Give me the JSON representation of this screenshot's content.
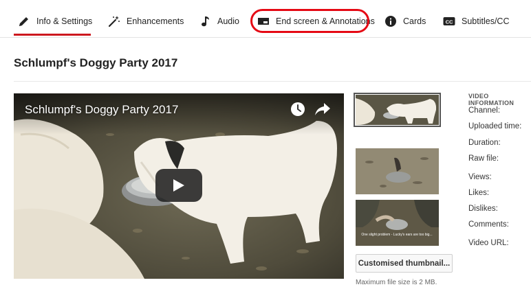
{
  "tabs": [
    {
      "label": "Info & Settings",
      "icon": "pencil-icon",
      "active": true
    },
    {
      "label": "Enhancements",
      "icon": "magic-wand-icon"
    },
    {
      "label": "Audio",
      "icon": "music-note-icon"
    },
    {
      "label": "End screen & Annotations",
      "icon": "end-screen-icon",
      "highlighted": true
    },
    {
      "label": "Cards",
      "icon": "info-icon"
    },
    {
      "label": "Subtitles/CC",
      "icon": "cc-icon"
    }
  ],
  "page": {
    "title": "Schlumpf's Doggy Party 2017"
  },
  "player": {
    "title": "Schlumpf's Doggy Party 2017"
  },
  "thumbnails": {
    "thumb3_caption": "One slight problem - Lucky's ears are too big...",
    "custom_button": "Customised thumbnail...",
    "max_size": "Maximum file size is 2 MB."
  },
  "video_info": {
    "heading": "VIDEO INFORMATION",
    "labels": [
      "Channel:",
      "Uploaded time:",
      "Duration:",
      "Raw file:",
      "Views:",
      "Likes:",
      "Dislikes:",
      "Comments:",
      "Video URL:"
    ]
  },
  "colors": {
    "accent": "#cc181e",
    "highlight_ring": "#e50914"
  }
}
